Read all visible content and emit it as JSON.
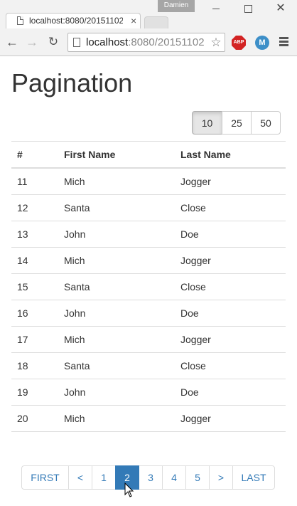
{
  "browser": {
    "tab_title": "localhost:8080/20151102-",
    "tab_close": "×",
    "user_badge": "Damien",
    "window_close": "✕",
    "url_main": "localhost",
    "url_rest": ":8080/20151102",
    "ext_abp": "ABP",
    "ext_m": "M"
  },
  "page": {
    "title": "Pagination",
    "page_size": {
      "options": [
        "10",
        "25",
        "50"
      ],
      "selected": "10"
    },
    "table": {
      "headers": [
        "#",
        "First Name",
        "Last Name"
      ],
      "rows": [
        [
          "11",
          "Mich",
          "Jogger"
        ],
        [
          "12",
          "Santa",
          "Close"
        ],
        [
          "13",
          "John",
          "Doe"
        ],
        [
          "14",
          "Mich",
          "Jogger"
        ],
        [
          "15",
          "Santa",
          "Close"
        ],
        [
          "16",
          "John",
          "Doe"
        ],
        [
          "17",
          "Mich",
          "Jogger"
        ],
        [
          "18",
          "Santa",
          "Close"
        ],
        [
          "19",
          "John",
          "Doe"
        ],
        [
          "20",
          "Mich",
          "Jogger"
        ]
      ]
    },
    "pagination": {
      "items": [
        "FIRST",
        "<",
        "1",
        "2",
        "3",
        "4",
        "5",
        ">",
        "LAST"
      ],
      "active": "2"
    }
  },
  "colors": {
    "link": "#337ab7",
    "active_page_bg": "#337ab7",
    "border": "#dddddd"
  }
}
